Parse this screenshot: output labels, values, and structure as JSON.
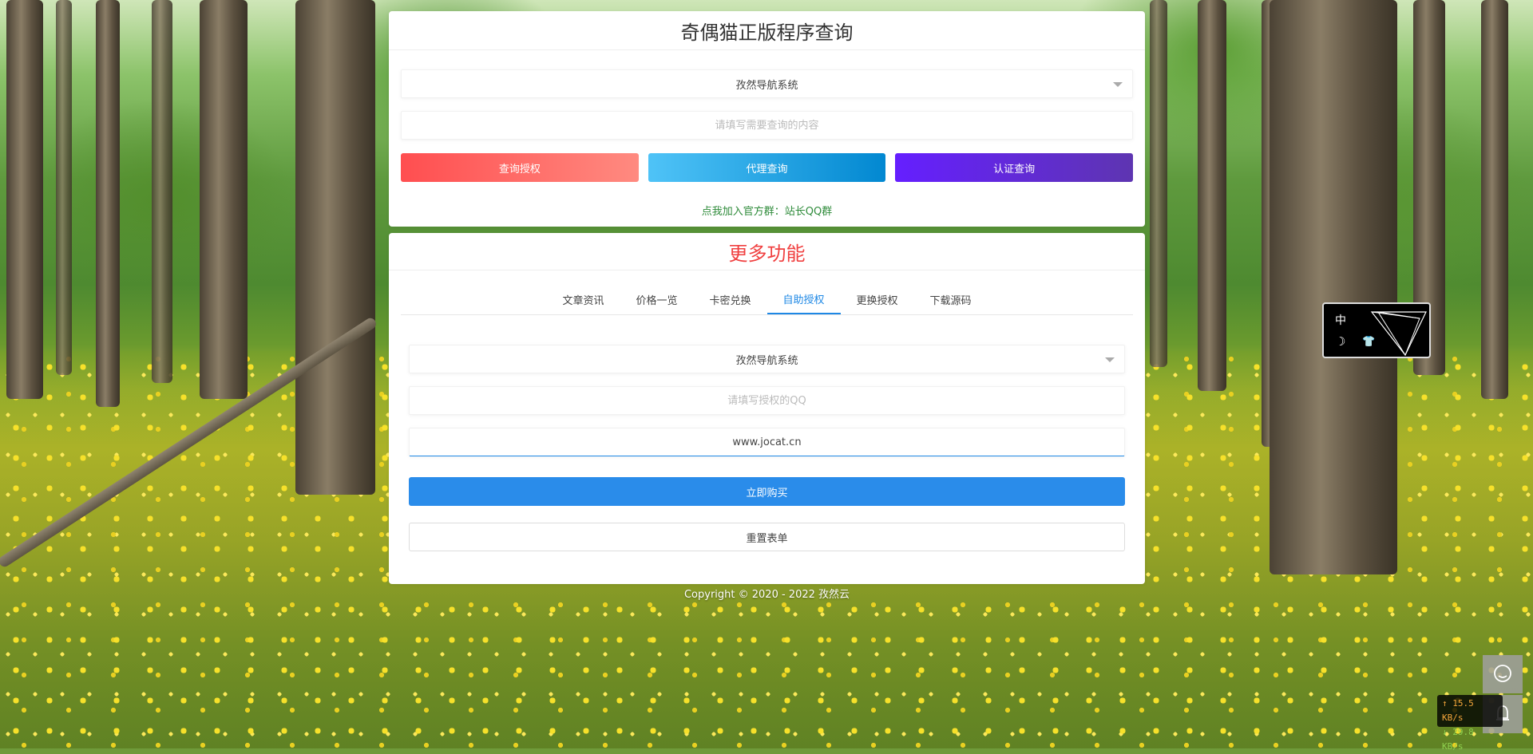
{
  "query_card": {
    "title": "奇偶猫正版程序查询",
    "program_select": "孜然导航系统",
    "query_placeholder": "请填写需要查询的内容",
    "buttons": {
      "auth": "查询授权",
      "agent": "代理查询",
      "cert": "认证查询"
    },
    "group_link": "点我加入官方群：站长QQ群"
  },
  "more_card": {
    "title": "更多功能",
    "tabs": [
      {
        "label": "文章资讯"
      },
      {
        "label": "价格一览"
      },
      {
        "label": "卡密兑换"
      },
      {
        "label": "自助授权"
      },
      {
        "label": "更换授权"
      },
      {
        "label": "下载源码"
      }
    ],
    "active_tab": "自助授权",
    "program_select": "孜然导航系统",
    "qq_placeholder": "请填写授权的QQ",
    "domain_value": "www.jocat.cn",
    "buy_label": "立即购买",
    "reset_label": "重置表单"
  },
  "footer": {
    "copyright": "Copyright © 2020 - 2022 孜然云"
  },
  "widget": {
    "lang": "中"
  },
  "net_speed": {
    "up": "↑ 15.5 KB/s",
    "down": "↓ 29.8 KB/s"
  },
  "colors": {
    "accent_blue": "#1e88e5",
    "title_red": "#f04040",
    "link_green": "#2e8b3a"
  }
}
